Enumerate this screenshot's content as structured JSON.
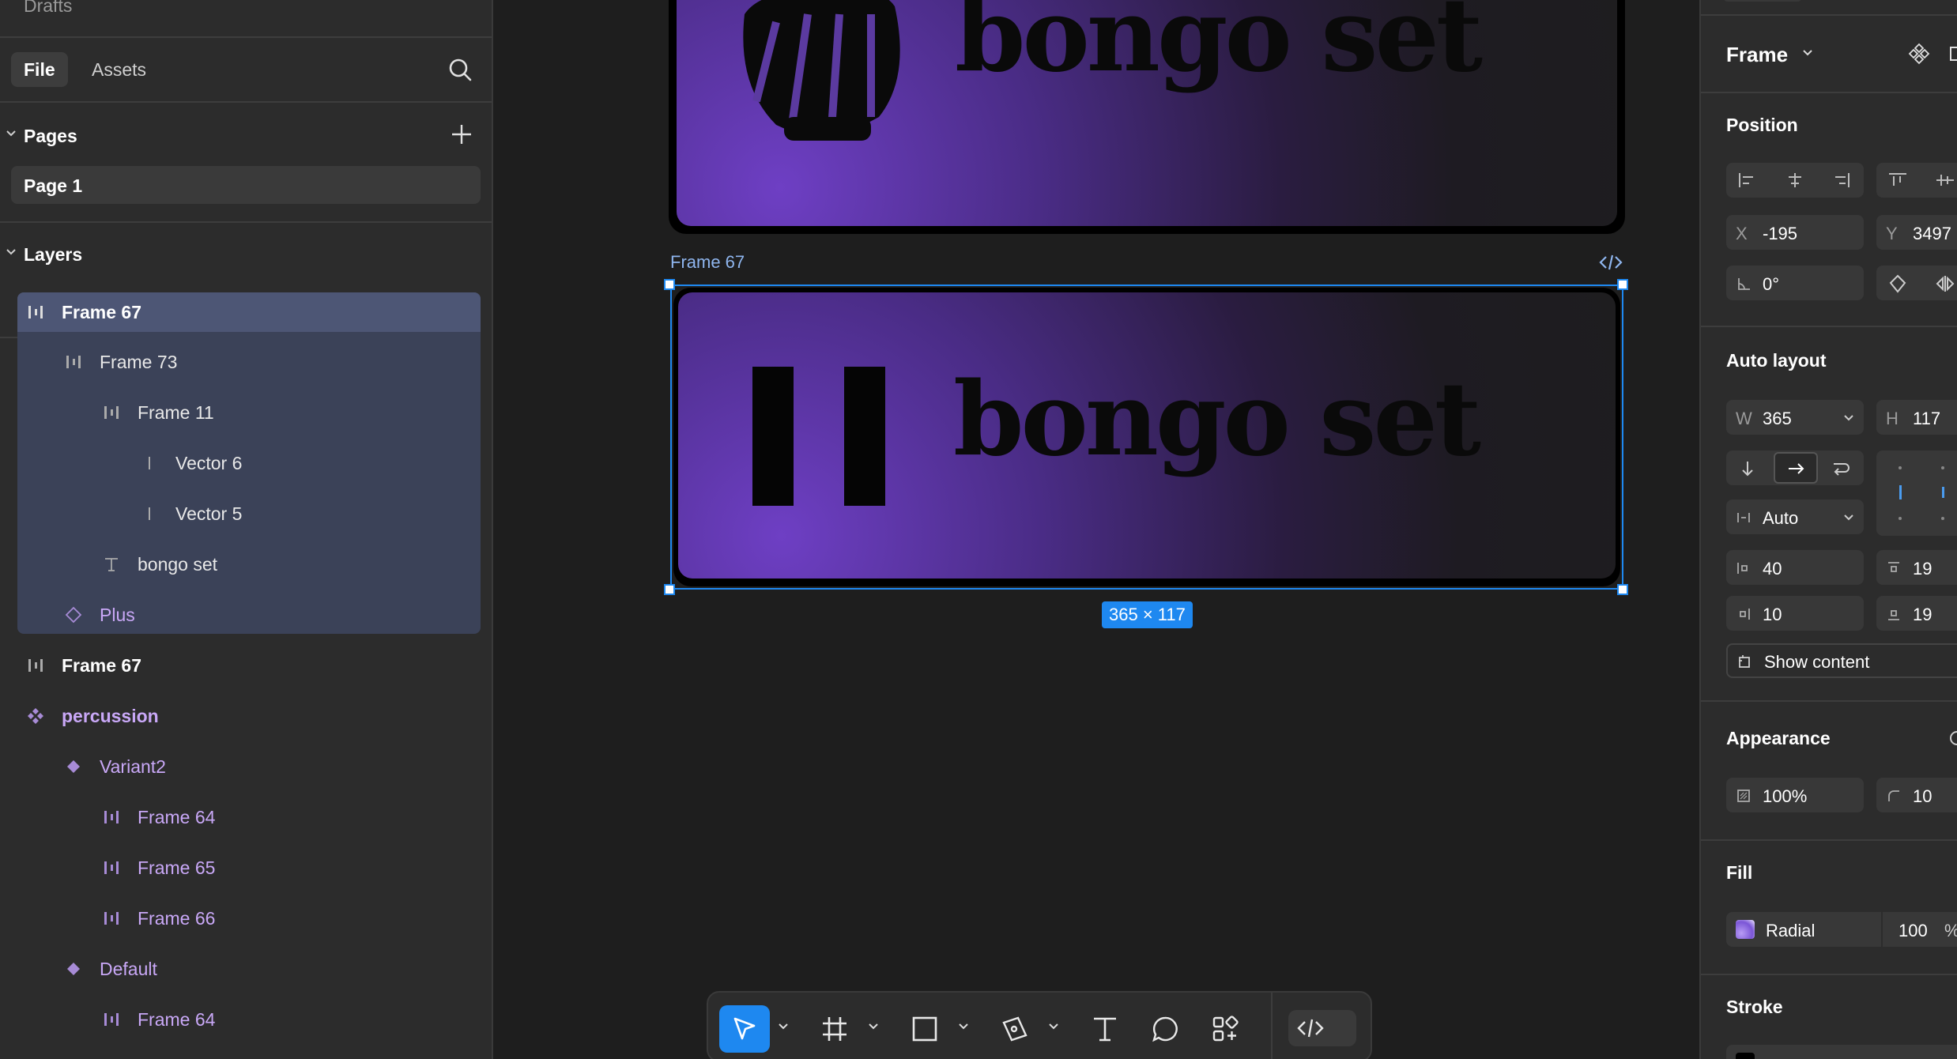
{
  "left_panel": {
    "drafts": "Drafts",
    "tabs": [
      {
        "label": "File"
      },
      {
        "label": "Assets"
      }
    ],
    "pages_title": "Pages",
    "pages": [
      {
        "label": "Page 1"
      }
    ],
    "layers_title": "Layers",
    "layers": [
      {
        "name": "Frame 67"
      },
      {
        "name": "Frame 73"
      },
      {
        "name": "Frame 11"
      },
      {
        "name": "Vector 6"
      },
      {
        "name": "Vector 5"
      },
      {
        "name": "bongo set"
      },
      {
        "name": "Plus"
      },
      {
        "name": "Frame 67"
      },
      {
        "name": "percussion"
      },
      {
        "name": "Variant2"
      },
      {
        "name": "Frame 64"
      },
      {
        "name": "Frame 65"
      },
      {
        "name": "Frame 66"
      },
      {
        "name": "Default"
      },
      {
        "name": "Frame 64"
      }
    ]
  },
  "canvas": {
    "top_frame_text": "bongo set",
    "selected_frame_label": "Frame 67",
    "selected_frame_text": "bongo set",
    "size_badge": "365 × 117",
    "brand_colors": {
      "purple": "#6e3fc4",
      "selection": "#1e88f0"
    }
  },
  "toolbar": {
    "tools": [
      "move-tool",
      "frame-tool",
      "rectangle-tool",
      "pen-tool",
      "text-tool",
      "comment-tool",
      "actions-tool",
      "dev-mode-toggle"
    ]
  },
  "right_panel": {
    "frame_dropdown": "Frame",
    "position": {
      "title": "Position",
      "x_label": "X",
      "x_value": "-195",
      "y_label": "Y",
      "y_value": "3497",
      "rotation_value": "0°"
    },
    "auto_layout": {
      "title": "Auto layout",
      "w_label": "W",
      "w_value": "365",
      "h_label": "H",
      "h_value": "117",
      "gap_value": "Auto",
      "padding_left": "40",
      "padding_top": "19",
      "padding_right": "10",
      "padding_bottom": "19",
      "show_content": "Show content"
    },
    "appearance": {
      "title": "Appearance",
      "opacity": "100%",
      "radius": "10"
    },
    "fill": {
      "title": "Fill",
      "type": "Radial",
      "opacity": "100",
      "percent_sign": "%"
    },
    "stroke": {
      "title": "Stroke"
    }
  }
}
